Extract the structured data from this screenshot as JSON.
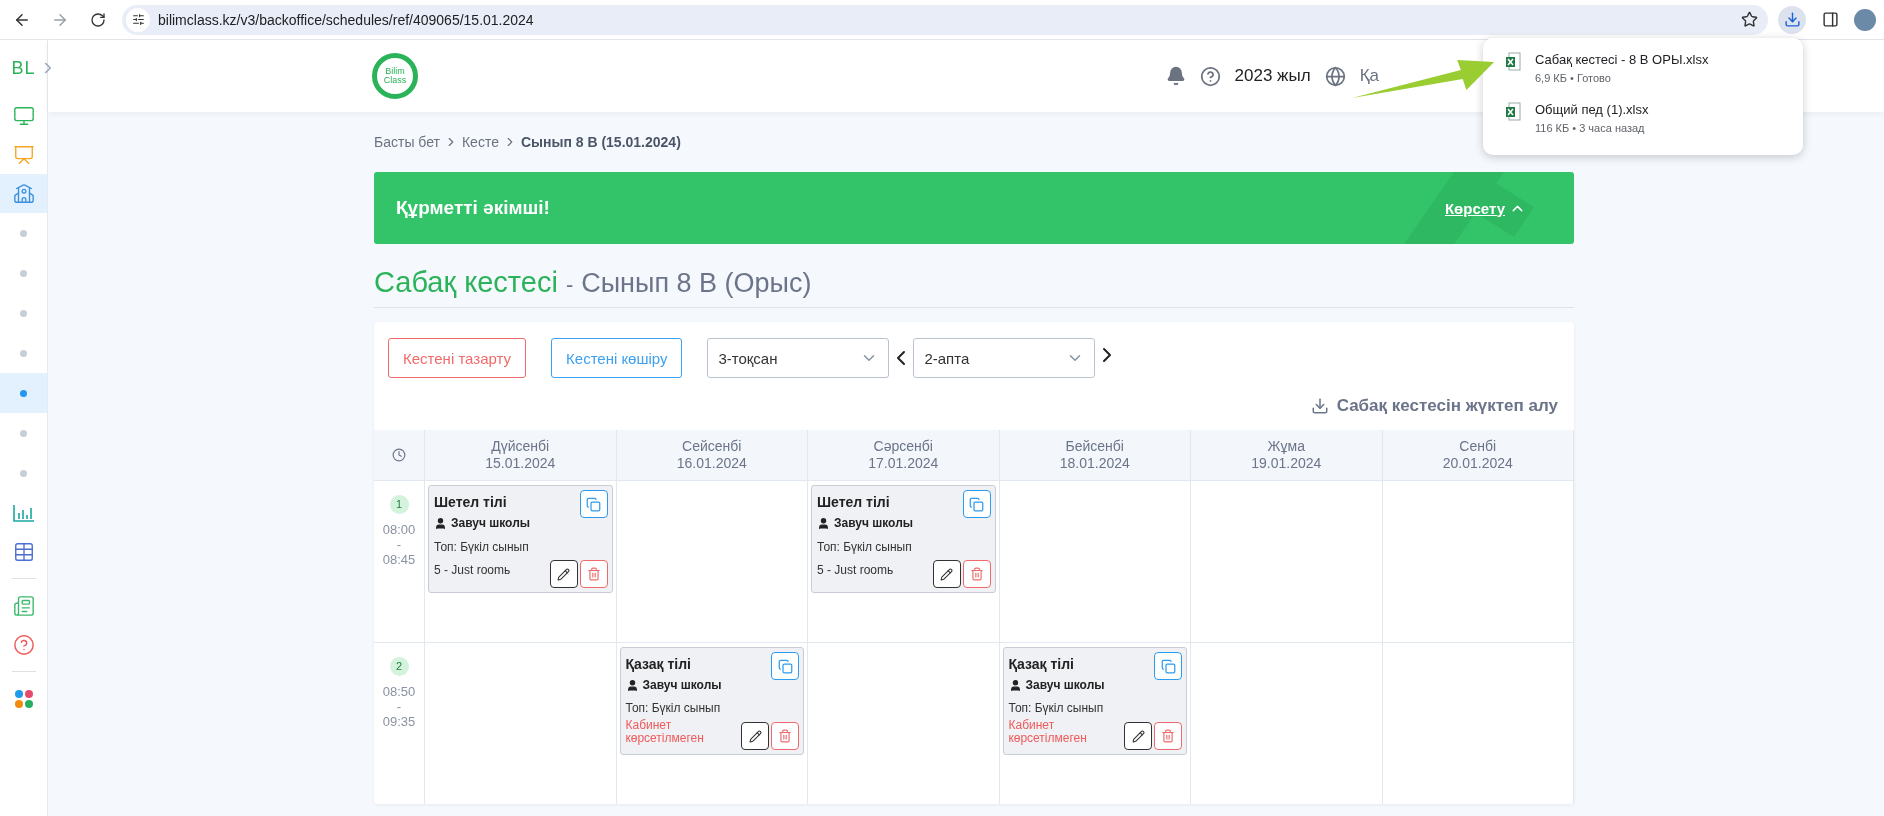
{
  "browser": {
    "url": "bilimclass.kz/v3/backoffice/schedules/ref/409065/15.01.2024"
  },
  "downloads": [
    {
      "name": "Сабақ кестесі - 8 В ОРЫ.xlsx",
      "meta": "6,9 КБ • Готово"
    },
    {
      "name": "Общий пед (1).xlsx",
      "meta": "116 КБ • 3 часа назад"
    }
  ],
  "sidebar": {
    "logo": "BL",
    "items": [
      {
        "kind": "icon",
        "selected": false
      },
      {
        "kind": "icon",
        "selected": false
      },
      {
        "kind": "icon",
        "selected": true
      },
      {
        "kind": "dot",
        "selected": false
      },
      {
        "kind": "dot",
        "selected": false
      },
      {
        "kind": "dot",
        "selected": false
      },
      {
        "kind": "dot",
        "selected": false
      },
      {
        "kind": "dot",
        "selected": true
      },
      {
        "kind": "dot",
        "selected": false
      },
      {
        "kind": "dot",
        "selected": false
      },
      {
        "kind": "icon",
        "selected": false
      },
      {
        "kind": "icon",
        "selected": false
      },
      {
        "kind": "divider"
      },
      {
        "kind": "icon",
        "selected": false
      },
      {
        "kind": "icon",
        "selected": false
      },
      {
        "kind": "divider"
      },
      {
        "kind": "icon",
        "selected": false
      }
    ]
  },
  "header": {
    "logo_text": [
      "Bilim",
      "Class"
    ],
    "year": "2023 жыл",
    "language": "Қа"
  },
  "breadcrumb": [
    {
      "label": "Басты бет",
      "current": false
    },
    {
      "label": "Кесте",
      "current": false
    },
    {
      "label": "Сынып 8 В (15.01.2024)",
      "current": true
    }
  ],
  "banner": {
    "title": "Құрметті әкімші!",
    "action": "Көрсету"
  },
  "page_title": {
    "main": "Сабақ кестесі",
    "separator": "-",
    "sub": "Сынып 8 В (Орыс)"
  },
  "toolbar": {
    "clear_button": "Кестені тазарту",
    "copy_button": "Кестені көшіру",
    "quarter": "3-тоқсан",
    "week": "2-апта",
    "download_link": "Сабақ кестесін жүктеп алу"
  },
  "days": [
    {
      "name": "Дүйсенбі",
      "date": "15.01.2024"
    },
    {
      "name": "Сейсенбі",
      "date": "16.01.2024"
    },
    {
      "name": "Сәрсенбі",
      "date": "17.01.2024"
    },
    {
      "name": "Бейсенбі",
      "date": "18.01.2024"
    },
    {
      "name": "Жұма",
      "date": "19.01.2024"
    },
    {
      "name": "Сенбі",
      "date": "20.01.2024"
    }
  ],
  "rows": [
    {
      "number": "1",
      "start": "08:00",
      "dash": "-",
      "end": "08:45",
      "cells": [
        {
          "subject": "Шетел тілі",
          "teacher": "Завуч школы",
          "group": "Топ: Бүкіл сынып",
          "room": "5 - Just roomь",
          "kind": "room"
        },
        null,
        {
          "subject": "Шетел тілі",
          "teacher": "Завуч школы",
          "group": "Топ: Бүкіл сынып",
          "room": "5 - Just roomь",
          "kind": "room"
        },
        null,
        null,
        null
      ]
    },
    {
      "number": "2",
      "start": "08:50",
      "dash": "-",
      "end": "09:35",
      "cells": [
        null,
        {
          "subject": "Қазақ тілі",
          "teacher": "Завуч школы",
          "group": "Топ: Бүкіл сынып",
          "room": "Кабинет көрсетілмеген",
          "kind": "no_room"
        },
        null,
        {
          "subject": "Қазақ тілі",
          "teacher": "Завуч школы",
          "group": "Топ: Бүкіл сынып",
          "room": "Кабинет көрсетілмеген",
          "kind": "no_room"
        },
        null,
        null
      ]
    }
  ]
}
